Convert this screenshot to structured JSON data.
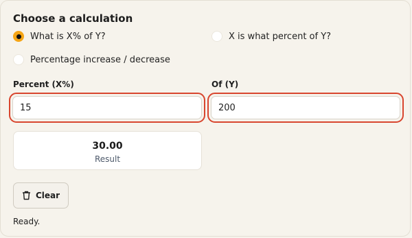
{
  "section_title": "Choose a calculation",
  "modes": [
    {
      "label": "What is X% of Y?",
      "selected": true
    },
    {
      "label": "X is what percent of Y?",
      "selected": false
    },
    {
      "label": "Percentage increase / decrease",
      "selected": false
    }
  ],
  "inputs": {
    "percent": {
      "label": "Percent (X%)",
      "value": "15"
    },
    "of": {
      "label": "Of (Y)",
      "value": "200"
    }
  },
  "result": {
    "value": "30.00",
    "caption": "Result"
  },
  "clear_label": "Clear",
  "status": "Ready.",
  "colors": {
    "accent": "#f5a516",
    "highlight_border": "#d8452e",
    "background": "#f6f3ec"
  },
  "icons": {
    "clear": "trash-icon"
  }
}
